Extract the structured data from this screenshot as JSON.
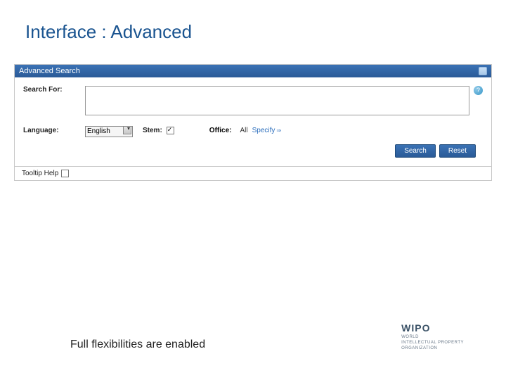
{
  "slide": {
    "title": "Interface : Advanced",
    "caption": "Full flexibilities are enabled"
  },
  "panel": {
    "header": "Advanced Search"
  },
  "form": {
    "searchForLabel": "Search For:",
    "searchValue": "",
    "languageLabel": "Language:",
    "languageValue": "English",
    "stemLabel": "Stem:",
    "stemChecked": true,
    "officeLabel": "Office:",
    "officeAll": "All",
    "specifyLink": "Specify"
  },
  "buttons": {
    "search": "Search",
    "reset": "Reset"
  },
  "footer": {
    "tooltipHelpLabel": "Tooltip Help"
  },
  "brand": {
    "name": "WIPO",
    "line1": "WORLD",
    "line2": "INTELLECTUAL PROPERTY",
    "line3": "ORGANIZATION"
  }
}
